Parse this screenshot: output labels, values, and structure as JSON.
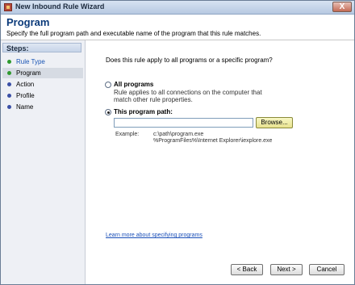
{
  "window": {
    "title": "New Inbound Rule Wizard",
    "close_glyph": "X"
  },
  "header": {
    "heading": "Program",
    "description": "Specify the full program path and executable name of the program that this rule matches."
  },
  "steps": {
    "title": "Steps:",
    "items": [
      {
        "label": "Rule Type",
        "state": "done"
      },
      {
        "label": "Program",
        "state": "current"
      },
      {
        "label": "Action",
        "state": "pending"
      },
      {
        "label": "Profile",
        "state": "pending"
      },
      {
        "label": "Name",
        "state": "pending"
      }
    ]
  },
  "main": {
    "question": "Does this rule apply to all programs or a specific program?",
    "options": {
      "all_programs": {
        "label": "All programs",
        "description": "Rule applies to all connections on the computer that match other rule properties.",
        "selected": false
      },
      "this_program": {
        "label": "This program path:",
        "selected": true,
        "value": "",
        "browse_label": "Browse..."
      }
    },
    "example": {
      "label": "Example:",
      "lines": [
        "c:\\path\\program.exe",
        "%ProgramFiles%\\Internet Explorer\\iexplore.exe"
      ]
    },
    "learn_link": "Learn more about specifying programs"
  },
  "footer": {
    "back_label": "< Back",
    "next_label": "Next >",
    "cancel_label": "Cancel"
  },
  "colors": {
    "heading": "#0b3a7a",
    "done_step": "#1b56b5",
    "link": "#1a4fb8",
    "done_bullet": "#2e9a2e",
    "pending_bullet": "#3a4fa6"
  }
}
